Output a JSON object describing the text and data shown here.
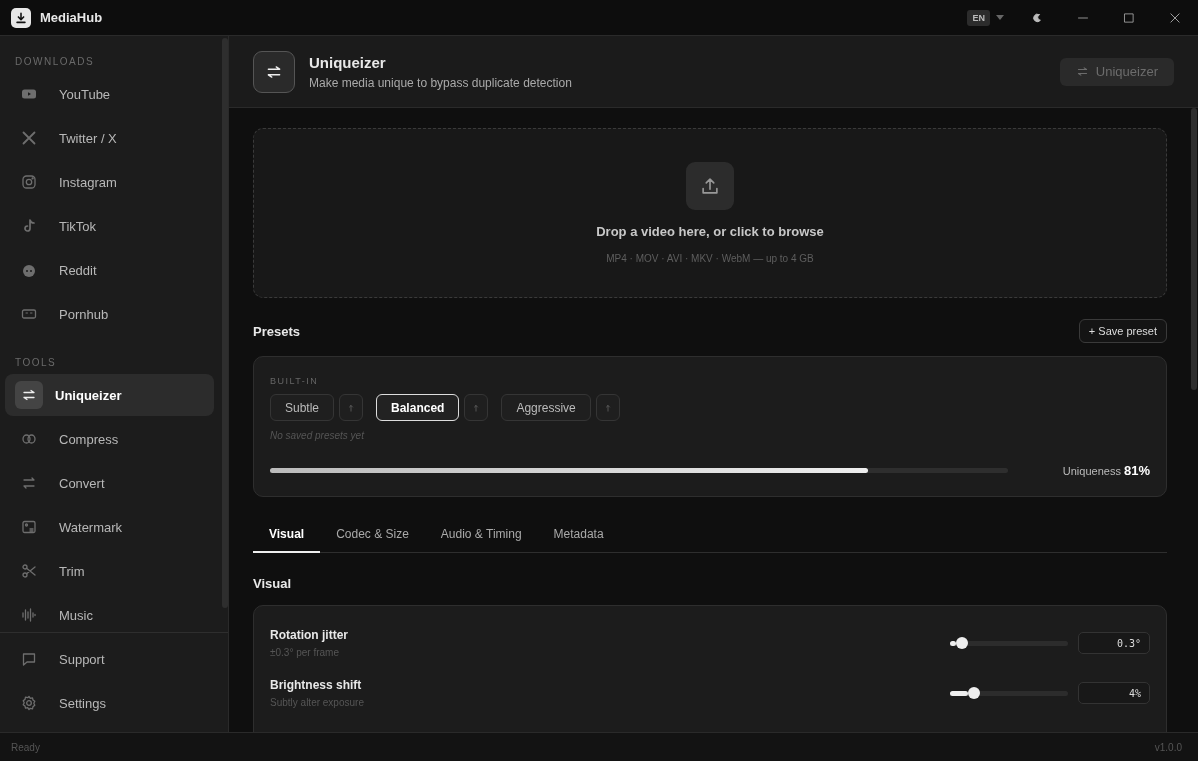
{
  "window": {
    "app_name": "MediaHub",
    "language": "EN"
  },
  "sidebar": {
    "sections": [
      {
        "heading": "DOWNLOADS",
        "items": [
          {
            "label": "YouTube",
            "selected": false
          },
          {
            "label": "Twitter / X",
            "selected": false
          },
          {
            "label": "Instagram",
            "selected": false
          },
          {
            "label": "TikTok",
            "selected": false
          },
          {
            "label": "Reddit",
            "selected": false
          },
          {
            "label": "Pornhub",
            "selected": false
          }
        ]
      },
      {
        "heading": "TOOLS",
        "items": [
          {
            "label": "Uniqueizer",
            "selected": true
          },
          {
            "label": "Compress",
            "selected": false
          },
          {
            "label": "Convert",
            "selected": false
          },
          {
            "label": "Watermark",
            "selected": false
          },
          {
            "label": "Trim",
            "selected": false
          },
          {
            "label": "Music",
            "selected": false
          }
        ]
      }
    ],
    "footer_items": [
      {
        "label": "Support",
        "selected": false
      },
      {
        "label": "Settings",
        "selected": false
      }
    ]
  },
  "header": {
    "title": "Uniqueizer",
    "subtitle": "Make media unique to bypass duplicate detection",
    "action": {
      "label": "Uniqueizer",
      "disabled": true
    }
  },
  "dropzone": {
    "title": "Drop a video here, or click to browse",
    "formats": "MP4 · MOV · AVI · MKV · WebM — up to 4 GB"
  },
  "presets": {
    "title": "Presets",
    "save_button": "+ Save preset",
    "group_label": "BUILT-IN",
    "items": [
      {
        "label": "Subtle",
        "selected": false
      },
      {
        "label": "Balanced",
        "selected": true
      },
      {
        "label": "Aggressive",
        "selected": false
      }
    ],
    "empty_note": "No saved presets yet",
    "uniqueness": {
      "label": "Uniqueness",
      "value": "81%",
      "level": 0.81
    }
  },
  "tabs": [
    {
      "label": "Visual",
      "selected": true
    },
    {
      "label": "Codec & Size",
      "selected": false
    },
    {
      "label": "Audio & Timing",
      "selected": false
    },
    {
      "label": "Metadata",
      "selected": false
    }
  ],
  "settings": {
    "title": "Visual",
    "rows": [
      {
        "label": "Rotation jitter",
        "description": "±0.3° per frame",
        "level": 0.1,
        "value": "0.3°"
      },
      {
        "label": "Brightness shift",
        "description": "Subtly alter exposure",
        "level": 0.2,
        "value": "4%"
      }
    ]
  },
  "status_bar": {
    "status": "Ready",
    "version": "v1.0.0"
  }
}
